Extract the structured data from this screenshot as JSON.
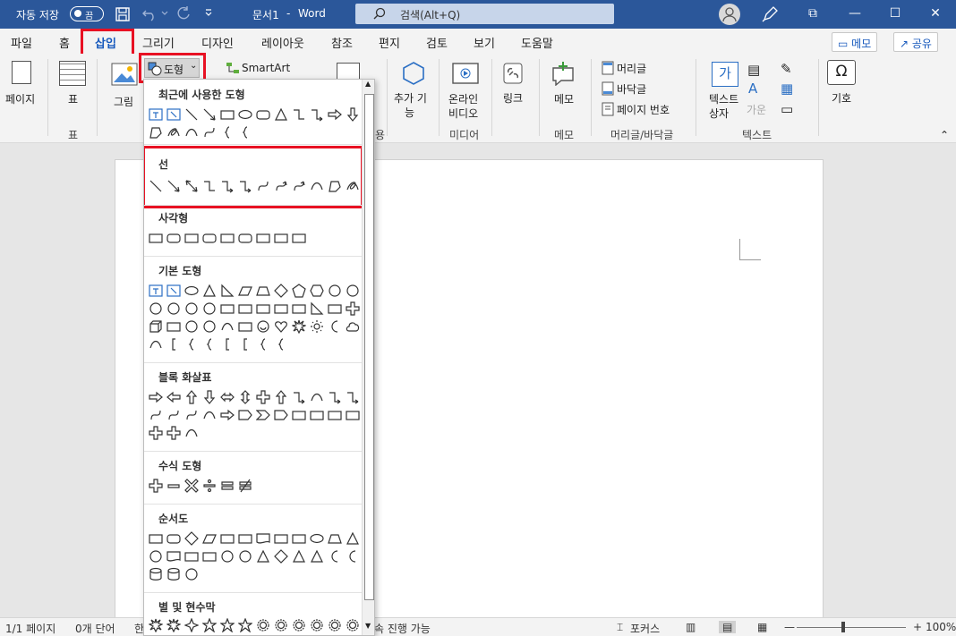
{
  "titlebar": {
    "autosave_label": "자동 저장",
    "autosave_state": "끔",
    "doc_title": "문서1",
    "separator": "-",
    "app_name": "Word",
    "search_placeholder": "검색(Alt+Q)",
    "minimize": "—",
    "maximize": "☐",
    "close": "✕",
    "restore_icon": "⧉"
  },
  "tabs": [
    "파일",
    "홈",
    "삽입",
    "그리기",
    "디자인",
    "레이아웃",
    "참조",
    "편지",
    "검토",
    "보기",
    "도움말"
  ],
  "header_buttons": {
    "comments": "메모",
    "share": "공유"
  },
  "ribbon": {
    "pages_label": "페이지",
    "table_label": "표",
    "table_group": "표",
    "pictures_label": "그림",
    "shapes_label": "도형",
    "smartart_label": "SmartArt",
    "addins_line1": "추가 기",
    "addins_line2": "능",
    "online_video_line1": "온라인",
    "online_video_line2": "비디오",
    "media_group": "미디어",
    "link_label": "링크",
    "comment_label": "메모",
    "comment_group": "메모",
    "header_label": "머리글",
    "footer_label": "바닥글",
    "page_number_label": "페이지 번호",
    "header_footer_group": "머리글/바닥글",
    "textbox_line1": "텍스트",
    "textbox_line2": "상자",
    "dropcap_label": "가운",
    "text_group": "텍스트",
    "symbol_label": "기호",
    "illust_group_partial": "용",
    "textbox_icon_char": "가"
  },
  "shapes_menu": {
    "recent": "최근에 사용한 도형",
    "lines": "선",
    "rectangles": "사각형",
    "basic": "기본 도형",
    "block_arrows": "블록 화살표",
    "equation": "수식 도형",
    "flowchart": "순서도",
    "stars": "별 및 현수막"
  },
  "status": {
    "page": "1/1 페이지",
    "words": "0개 단어",
    "lang_partial": "한",
    "access_partial": "속 진행 가능",
    "focus": "포커스",
    "zoom": "100%"
  }
}
